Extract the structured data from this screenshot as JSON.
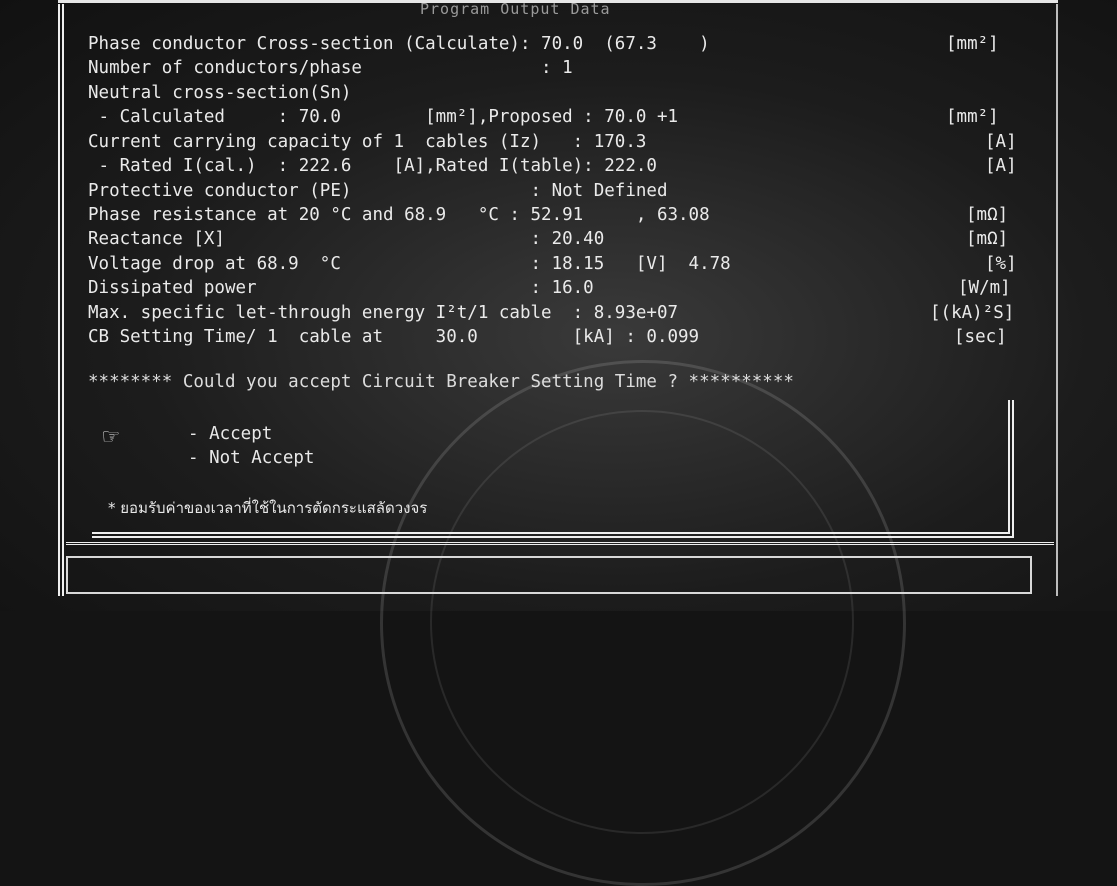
{
  "window": {
    "title": "Program Output Data"
  },
  "rows": [
    {
      "label": "Phase conductor Cross-section (Calculate): 70.0  (67.3    )",
      "unit": "[mm²]"
    },
    {
      "label": "Number of conductors/phase                 : 1",
      "unit": ""
    },
    {
      "label": "Neutral cross-section(Sn)",
      "unit": ""
    },
    {
      "label": " - Calculated     : 70.0        [mm²],Proposed : 70.0 +1",
      "unit": "[mm²]"
    },
    {
      "label": "Current carrying capacity of 1  cables (Iz)   : 170.3",
      "unit": "[A]"
    },
    {
      "label": " - Rated I(cal.)  : 222.6    [A],Rated I(table): 222.0",
      "unit": "[A]"
    },
    {
      "label": "Protective conductor (PE)                 : Not Defined",
      "unit": ""
    },
    {
      "label": "Phase resistance at 20 °C and 68.9   °C : 52.91     , 63.08",
      "unit": "[mΩ]"
    },
    {
      "label": "Reactance [X]                             : 20.40",
      "unit": "[mΩ]"
    },
    {
      "label": "Voltage drop at 68.9  °C                  : 18.15   [V]  4.78",
      "unit": "[%]"
    },
    {
      "label": "Dissipated power                          : 16.0",
      "unit": "[W/m]"
    },
    {
      "label": "Max. specific let-through energy I²t/1 cable  : 8.93e+07",
      "unit": "[(kA)²S]"
    },
    {
      "label": "CB Setting Time/ 1  cable at     30.0         [kA] : 0.099",
      "unit": "[sec]"
    }
  ],
  "prompt": "******** Could you accept Circuit Breaker Setting Time ? **********",
  "options": [
    {
      "label": "- Accept"
    },
    {
      "label": "- Not Accept"
    }
  ],
  "pointer_icon": "hand-pointer-icon",
  "hand_glyph": "☞",
  "hint": "* ยอมรับค่าของเวลาที่ใช้ในการตัดกระแสลัดวงจร",
  "colors": {
    "background": "#1c1c1c",
    "text": "#eaeaea",
    "border": "#efefef"
  }
}
